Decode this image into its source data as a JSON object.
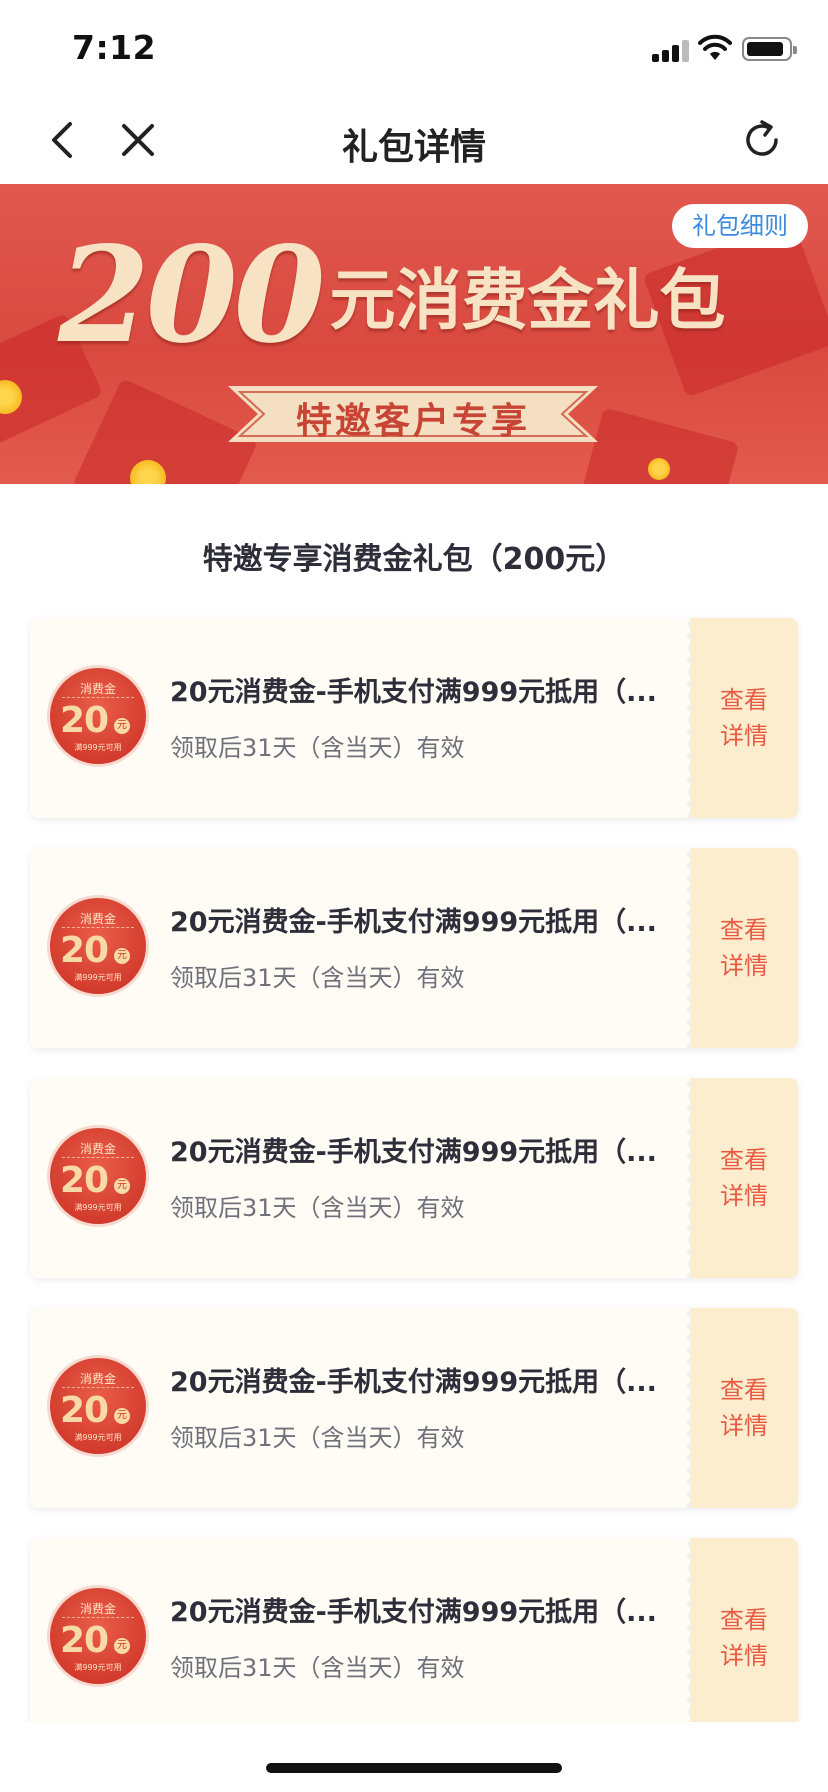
{
  "status_bar": {
    "time": "7:12"
  },
  "nav": {
    "title": "礼包详情"
  },
  "banner": {
    "amount": "200",
    "title_suffix": "元消费金礼包",
    "ribbon": "特邀客户专享",
    "rules_button": "礼包细则"
  },
  "section": {
    "title": "特邀专享消费金礼包（200元）"
  },
  "coupons": [
    {
      "badge_top": "消费金",
      "badge_amount": "20",
      "badge_unit": "元",
      "badge_bottom": "满999元可用",
      "name": "20元消费金-手机支付满999元抵用（...",
      "validity": "领取后31天（含当天）有效",
      "detail": "查看详情"
    },
    {
      "badge_top": "消费金",
      "badge_amount": "20",
      "badge_unit": "元",
      "badge_bottom": "满999元可用",
      "name": "20元消费金-手机支付满999元抵用（...",
      "validity": "领取后31天（含当天）有效",
      "detail": "查看详情"
    },
    {
      "badge_top": "消费金",
      "badge_amount": "20",
      "badge_unit": "元",
      "badge_bottom": "满999元可用",
      "name": "20元消费金-手机支付满999元抵用（...",
      "validity": "领取后31天（含当天）有效",
      "detail": "查看详情"
    },
    {
      "badge_top": "消费金",
      "badge_amount": "20",
      "badge_unit": "元",
      "badge_bottom": "满999元可用",
      "name": "20元消费金-手机支付满999元抵用（...",
      "validity": "领取后31天（含当天）有效",
      "detail": "查看详情"
    },
    {
      "badge_top": "消费金",
      "badge_amount": "20",
      "badge_unit": "元",
      "badge_bottom": "满999元可用",
      "name": "20元消费金-手机支付满999元抵用（...",
      "validity": "领取后31天（含当天）有效",
      "detail": "查看详情"
    }
  ],
  "icons": [
    "signal-icon",
    "wifi-icon",
    "battery-icon",
    "back-icon",
    "close-icon",
    "refresh-icon"
  ],
  "colors": {
    "banner": "#d9493f",
    "accent": "#e85a42",
    "link": "#3b8be0",
    "coupon_side": "#fcedce"
  }
}
